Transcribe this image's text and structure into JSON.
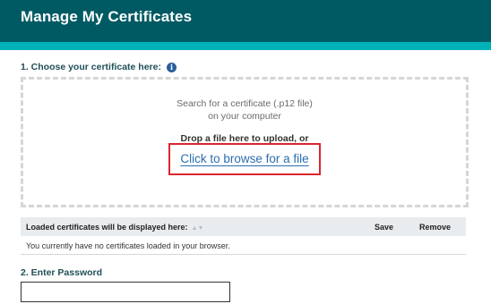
{
  "header": {
    "title": "Manage My Certificates"
  },
  "step1": {
    "label": "1. Choose your certificate here:",
    "info_icon": "info-icon"
  },
  "dropzone": {
    "search_line1": "Search for a certificate (.p12 file)",
    "search_line2": "on your computer",
    "drop_text": "Drop a file here to upload, or",
    "browse_link": "Click to browse for a file"
  },
  "table": {
    "columns": {
      "loaded": "Loaded certificates will be displayed here:",
      "save": "Save",
      "remove": "Remove"
    },
    "sort_icon": "sort-icon",
    "empty_message": "You currently have no certificates loaded in your browser."
  },
  "step2": {
    "label": "2. Enter Password",
    "password_value": ""
  },
  "colors": {
    "header_bg": "#005a63",
    "header_stripe": "#00b2b8",
    "link": "#2a6fb0",
    "highlight_border": "#d9262f"
  }
}
